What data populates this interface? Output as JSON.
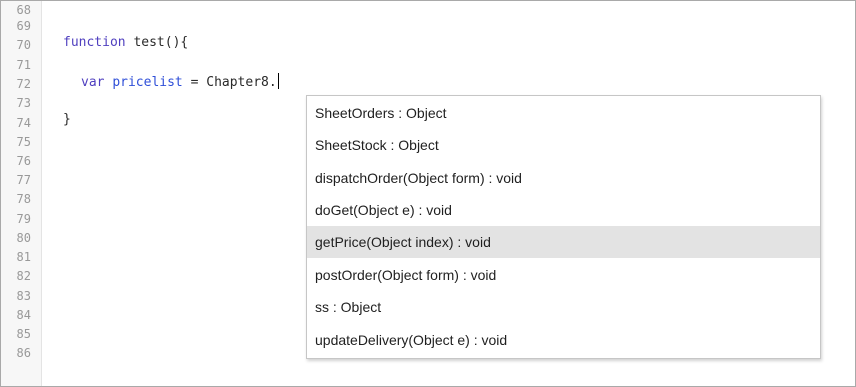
{
  "editor": {
    "line_numbers": [
      "68",
      "69",
      "70",
      "71",
      "72",
      "73",
      "74",
      "75",
      "76",
      "77",
      "78",
      "79",
      "80",
      "81",
      "82",
      "83",
      "84",
      "85",
      "86"
    ],
    "code": {
      "function_keyword": "function",
      "function_rest": " test(){",
      "var_keyword": "var",
      "variable_name": "pricelist",
      "assignment": " = Chapter8.",
      "closing_brace": "}"
    }
  },
  "autocomplete": {
    "selected_index": 4,
    "items": [
      "SheetOrders : Object",
      "SheetStock : Object",
      "dispatchOrder(Object form) : void",
      "doGet(Object e) : void",
      "getPrice(Object index) : void",
      "postOrder(Object form) : void",
      "ss : Object",
      "updateDelivery(Object e) : void"
    ]
  },
  "colors": {
    "keyword": "#4f3fbf",
    "variable": "#2f4fd8",
    "selected_background": "#e3e3e3"
  }
}
